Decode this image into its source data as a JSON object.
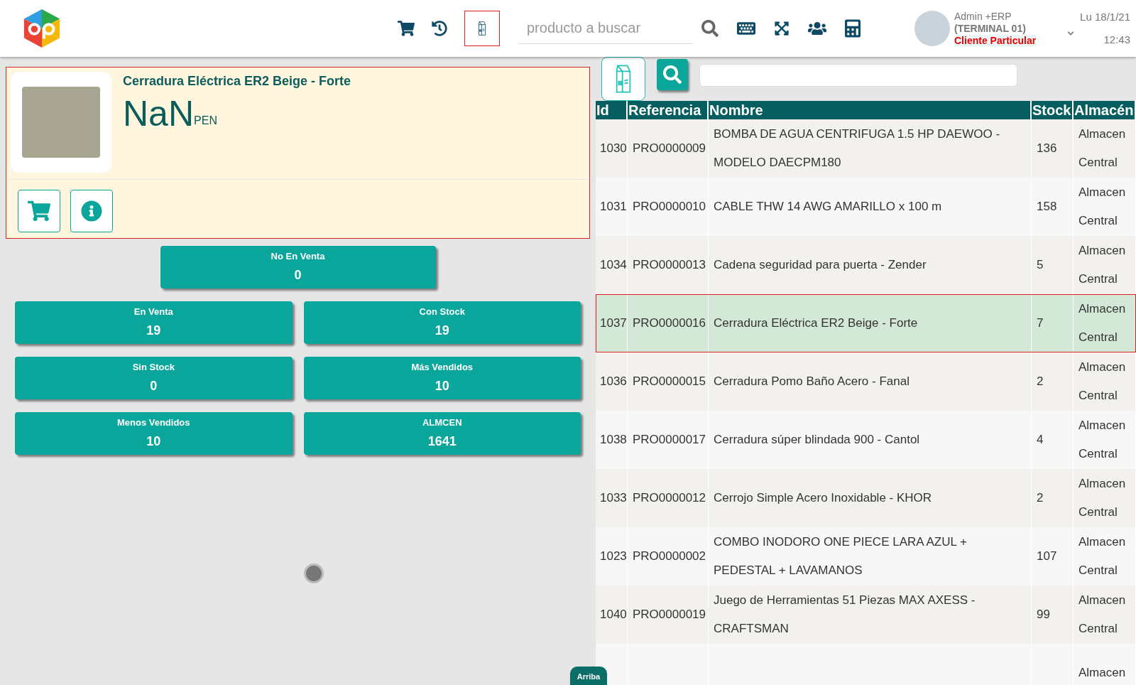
{
  "header": {
    "search": {
      "placeholder": "producto a buscar"
    },
    "user": {
      "name": "Admin +ERP",
      "terminal": "(TERMINAL 01)",
      "client": "Cliente Particular"
    },
    "date": "Lu 18/1/21",
    "time": "12:43"
  },
  "product": {
    "name": "Cerradura Eléctrica ER2 Beige - Forte",
    "price": "NaN",
    "currency": "PEN"
  },
  "tiles": [
    {
      "label": "No En Venta",
      "value": "0"
    },
    {
      "label": "En Venta",
      "value": "19"
    },
    {
      "label": "Con Stock",
      "value": "19"
    },
    {
      "label": "Sin Stock",
      "value": "0"
    },
    {
      "label": "Más Vendidos",
      "value": "10"
    },
    {
      "label": "Menos Vendidos",
      "value": "10"
    },
    {
      "label": "ALMCEN",
      "value": "1641"
    }
  ],
  "scroll_top_button": "Arriba",
  "table": {
    "columns": [
      "Id",
      "Referencia",
      "Nombre",
      "Stock",
      "Almacén"
    ],
    "rows": [
      {
        "id": "1030",
        "ref": "PRO0000009",
        "name": "BOMBA DE AGUA CENTRIFUGA 1.5 HP DAEWOO - MODELO DAECPM180",
        "stock": "136",
        "store": "Almacen Central",
        "selected": false
      },
      {
        "id": "1031",
        "ref": "PRO0000010",
        "name": "CABLE THW 14 AWG AMARILLO x 100 m",
        "stock": "158",
        "store": "Almacen Central",
        "selected": false
      },
      {
        "id": "1034",
        "ref": "PRO0000013",
        "name": "Cadena seguridad para puerta - Zender",
        "stock": "5",
        "store": "Almacen Central",
        "selected": false
      },
      {
        "id": "1037",
        "ref": "PRO0000016",
        "name": "Cerradura Eléctrica ER2 Beige - Forte",
        "stock": "7",
        "store": "Almacen Central",
        "selected": true
      },
      {
        "id": "1036",
        "ref": "PRO0000015",
        "name": "Cerradura Pomo Baño Acero - Fanal",
        "stock": "2",
        "store": "Almacen Central",
        "selected": false
      },
      {
        "id": "1038",
        "ref": "PRO0000017",
        "name": "Cerradura súper blindada 900 - Cantol",
        "stock": "4",
        "store": "Almacen Central",
        "selected": false
      },
      {
        "id": "1033",
        "ref": "PRO0000012",
        "name": "Cerrojo Simple Acero Inoxidable - KHOR",
        "stock": "2",
        "store": "Almacen Central",
        "selected": false
      },
      {
        "id": "1023",
        "ref": "PRO0000002",
        "name": "COMBO INODORO ONE PIECE LARA AZUL + PEDESTAL + LAVAMANOS",
        "stock": "107",
        "store": "Almacen Central",
        "selected": false
      },
      {
        "id": "1040",
        "ref": "PRO0000019",
        "name": "Juego de Herramientas 51 Piezas MAX AXESS - CRAFTSMAN",
        "stock": "99",
        "store": "Almacen Central",
        "selected": false
      },
      {
        "store": "Almacen",
        "selected": false
      }
    ]
  }
}
